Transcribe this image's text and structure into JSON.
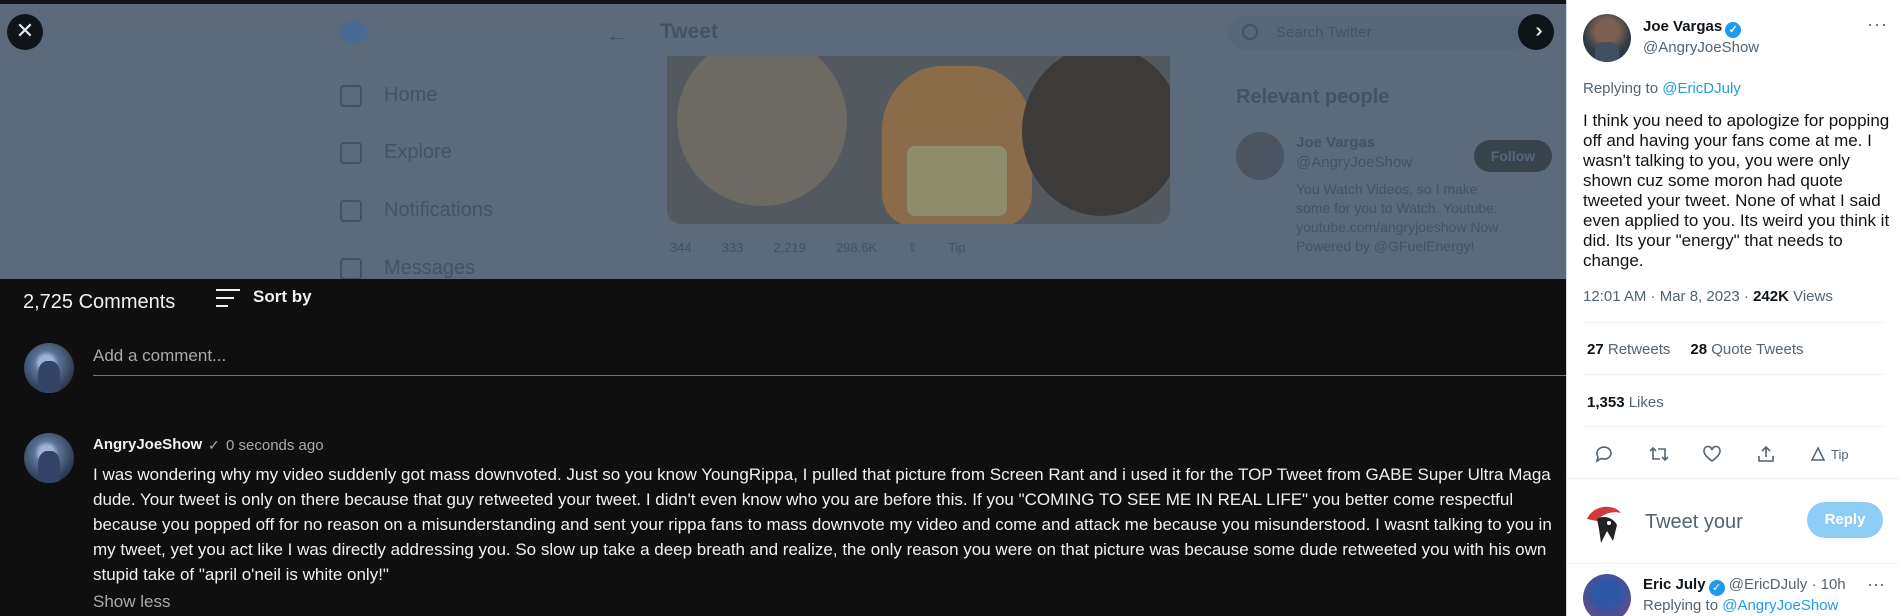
{
  "backdrop": {
    "nav": [
      "Home",
      "Explore",
      "Notifications",
      "Messages"
    ],
    "tweet_title": "Tweet",
    "back_icon": "back-arrow-icon",
    "search_placeholder": "Search Twitter",
    "relevant_people": "Relevant people",
    "rel_name": "Joe Vargas",
    "rel_handle": "@AngryJoeShow",
    "rel_bio": "You Watch Videos, so I make some for you to Watch. Youtube: youtube.com/angryjoeshow Now Powered by @GFuelEnergy!",
    "follow_label": "Follow",
    "stats": [
      "344",
      "333",
      "2,219",
      "298.6K",
      "",
      "Tip"
    ]
  },
  "overlay": {
    "close_icon": "close-icon",
    "collapse_icon": "double-chevron-right-icon"
  },
  "comments": {
    "count": "2,725 Comments",
    "sort_label": "Sort by",
    "add_placeholder": "Add a comment...",
    "item": {
      "author": "AngryJoeShow",
      "check": "✓",
      "time": "0 seconds ago",
      "text": "I was wondering why my video suddenly got mass downvoted. Just so you know YoungRippa, I pulled that picture from Screen Rant and i used it for the TOP Tweet from GABE Super Ultra Maga dude. Your tweet is only on there because that guy retweeted your tweet. I didn't even know who you are before this. If you \"COMING TO SEE ME IN REAL LIFE\" you better come respectful because you popped off for no reason on a misunderstanding and sent your rippa fans to mass downvote my video and come and attack me because you misunderstood. I wasnt talking to you in my tweet, yet you act like I was directly addressing you. So slow up take a deep breath and realize, the only reason you were on that picture was because some dude retweeted you with his own stupid take of \"april o'neil is white only!\"",
      "show_less": "Show less"
    }
  },
  "tweet": {
    "name": "Joe Vargas",
    "handle": "@AngryJoeShow",
    "replying_prefix": "Replying to ",
    "replying_to": "@EricDJuly",
    "text": "I think you need to apologize for popping off and having your fans come at me. I wasn't talking to you, you were only shown cuz some moron had quote tweeted your tweet. None of what I said even applied to you. Its weird you think it did. Its your \"energy\" that needs to change.",
    "timestamp": "12:01 AM · Mar 8, 2023 · ",
    "views_count": "242K",
    "views_label": " Views",
    "retweets_count": "27",
    "retweets_label": " Retweets",
    "quotes_count": "28",
    "quotes_label": " Quote Tweets",
    "likes_count": "1,353",
    "likes_label": " Likes",
    "tip_label": "Tip",
    "reply_placeholder": "Tweet your",
    "reply_button": "Reply",
    "next": {
      "name": "Eric July",
      "meta": " @EricDJuly · 10h",
      "replying_prefix": "Replying to ",
      "replying_to": "@AngryJoeShow"
    }
  },
  "colors": {
    "accent": "#1d9bf0",
    "yt_bg": "#0f0f0f",
    "backdrop": "#5b6b7c"
  }
}
